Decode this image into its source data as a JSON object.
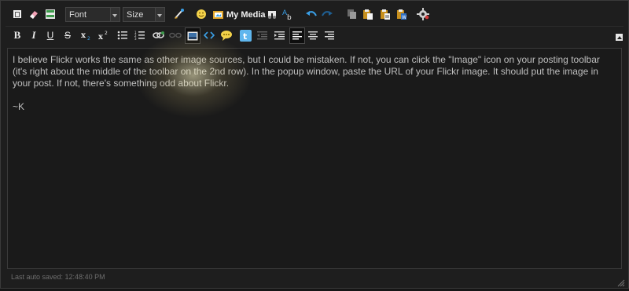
{
  "toolbar1": {
    "font_label": "Font",
    "size_label": "Size",
    "my_media_label": "My Media"
  },
  "content": {
    "paragraph": "I believe Flickr works the same as other image sources, but I could be mistaken. If not, you can click the \"Image\" icon on your posting toolbar (it's right about the middle of the toolbar on the 2nd row). In the popup window, paste the URL of your Flickr image. It should put the image in your post. If not, there's something odd about Flickr.",
    "signature": "~K"
  },
  "status": {
    "auto_saved": "Last auto saved: 12:48:40 PM"
  },
  "icons": {
    "row1": [
      "source-icon",
      "eraser-icon",
      "template-icon",
      "font-select",
      "size-select",
      "paint-icon",
      "smiley-icon",
      "my-media-icon",
      "find-icon",
      "replace-icon",
      "undo-icon",
      "redo-icon",
      "copy-icon",
      "paste-icon",
      "paste-text-icon",
      "paste-word-icon",
      "settings-icon"
    ],
    "row2": [
      "bold-icon",
      "italic-icon",
      "underline-icon",
      "strikethrough-icon",
      "subscript-icon",
      "superscript-icon",
      "bullet-list-icon",
      "numbered-list-icon",
      "link-icon",
      "unlink-icon",
      "image-icon",
      "code-icon",
      "quote-icon",
      "twitter-icon",
      "outdent-icon",
      "indent-icon",
      "align-left-icon",
      "align-center-icon",
      "align-right-icon"
    ]
  },
  "colors": {
    "background": "#1e1e1e",
    "text": "#bfbfbf",
    "accent_blue": "#3aa0e8",
    "paste_orange": "#e0a52a"
  }
}
